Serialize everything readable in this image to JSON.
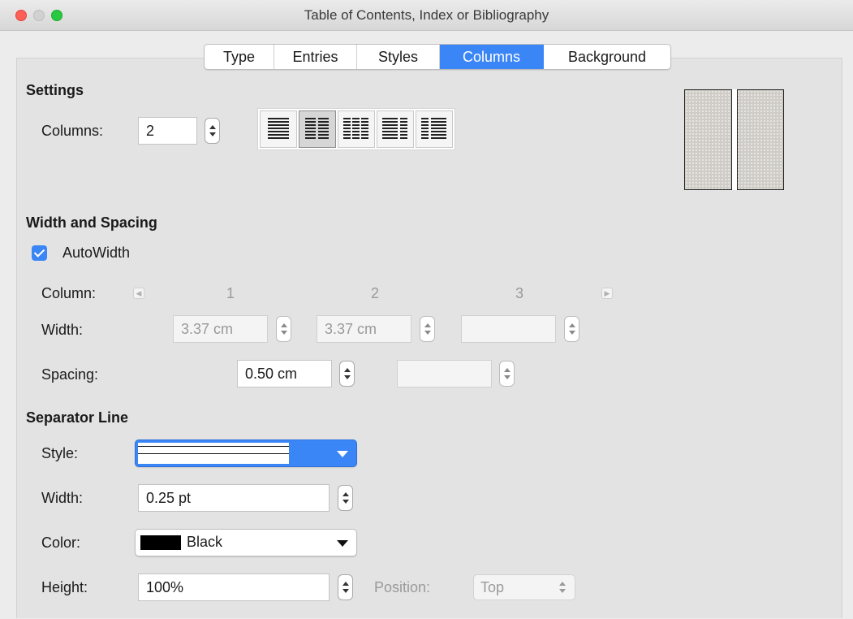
{
  "window": {
    "title": "Table of Contents, Index or Bibliography"
  },
  "tabs": [
    {
      "label": "Type"
    },
    {
      "label": "Entries"
    },
    {
      "label": "Styles"
    },
    {
      "label": "Columns",
      "active": true
    },
    {
      "label": "Background"
    }
  ],
  "settings": {
    "heading": "Settings",
    "columns_label": "Columns:",
    "columns_value": "2",
    "layout_presets": [
      "one-column",
      "two-columns",
      "three-columns",
      "left-wide",
      "right-wide"
    ],
    "selected_preset": "two-columns"
  },
  "width_spacing": {
    "heading": "Width and Spacing",
    "autowidth_label": "AutoWidth",
    "autowidth_checked": true,
    "column_label": "Column:",
    "column_numbers": [
      "1",
      "2",
      "3"
    ],
    "width_label": "Width:",
    "width_values": [
      "3.37 cm",
      "3.37 cm",
      ""
    ],
    "spacing_label": "Spacing:",
    "spacing_values": [
      "0.50 cm",
      ""
    ]
  },
  "separator": {
    "heading": "Separator Line",
    "style_label": "Style:",
    "width_label": "Width:",
    "width_value": "0.25 pt",
    "color_label": "Color:",
    "color_value": "Black",
    "color_hex": "#000000",
    "height_label": "Height:",
    "height_value": "100%",
    "position_label": "Position:",
    "position_value": "Top"
  },
  "colors": {
    "accent": "#3b86f6"
  }
}
